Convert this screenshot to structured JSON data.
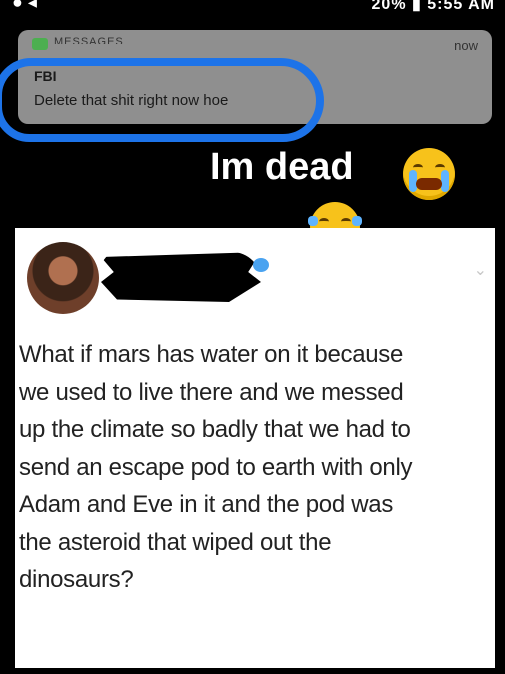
{
  "statusbar": {
    "time": "20% ▮ 5:55 AM"
  },
  "notification": {
    "app_name": "MESSAGES",
    "time": "now",
    "sender": "FBI",
    "message": "Delete that shit right now hoe"
  },
  "caption": {
    "text": "Im  dead"
  },
  "emojis": [
    "loudly-crying-face",
    "face-with-tears-of-joy"
  ],
  "tweet": {
    "lines": [
      "What if mars has water on it because",
      "we used to live there and we messed",
      "up the climate so badly that we had to",
      "send an escape pod to earth with only",
      "Adam and Eve in it and the pod was",
      "the asteroid that wiped out the",
      "dinosaurs?"
    ]
  },
  "colors": {
    "annotation": "#1d73e8",
    "notification_bg": "#8f8f8f",
    "emoji": "#f7c21b"
  }
}
